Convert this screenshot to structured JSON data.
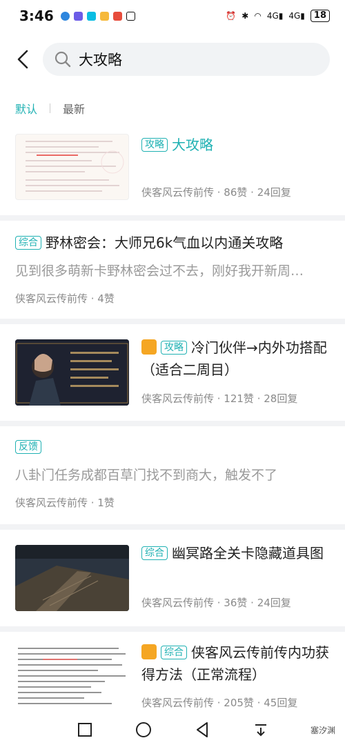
{
  "status_bar": {
    "time": "3:46",
    "battery": "18",
    "network_1": "4G",
    "network_2": "4G"
  },
  "search": {
    "query": "大攻略"
  },
  "sort_tabs": {
    "default": "默认",
    "latest": "最新"
  },
  "posts": [
    {
      "tag": "攻略",
      "title": "大攻略",
      "author": "侠客风云传前传",
      "likes": "86赞",
      "replies": "24回复",
      "meta": "侠客风云传前传 · 86赞 · 24回复"
    },
    {
      "tag": "综合",
      "title": "野林密会：大师兄6k气血以内通关攻略",
      "excerpt": "见到很多萌新卡野林密会过不去，刚好我开新周…",
      "meta": "侠客风云传前传 · 4赞"
    },
    {
      "tag": "攻略",
      "title": "冷门伙伴→内外功搭配（适合二周目）",
      "meta": "侠客风云传前传 · 121赞 · 28回复"
    },
    {
      "tag": "反馈",
      "excerpt": "八卦门任务成都百草门找不到商大，触发不了",
      "meta": "侠客风云传前传 · 1赞"
    },
    {
      "tag": "综合",
      "title": "幽冥路全关卡隐藏道具图",
      "meta": "侠客风云传前传 · 36赞 · 24回复"
    },
    {
      "tag": "综合",
      "title": "侠客风云传前传内功获得方法（正常流程）",
      "meta": "侠客风云传前传 · 205赞 · 45回复"
    }
  ],
  "watermark": "塞汐渊",
  "colors": {
    "accent": "#1fb1b3",
    "badge": "#f5a623"
  }
}
